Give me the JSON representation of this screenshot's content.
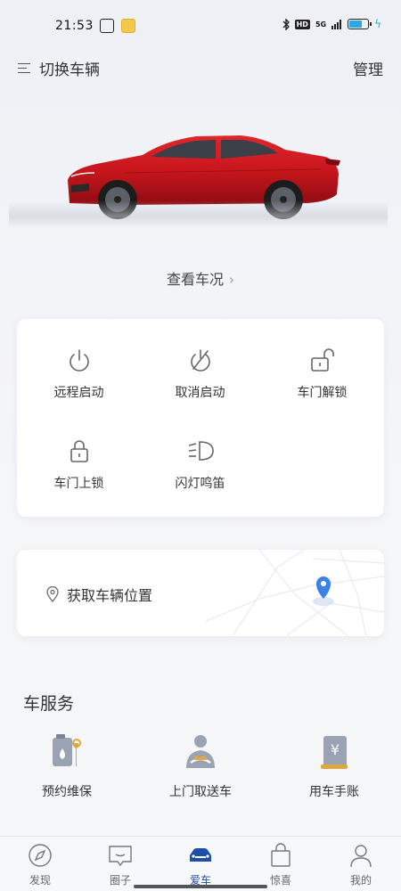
{
  "status_bar": {
    "time": "21:53",
    "network": "5G",
    "hd": "HD",
    "battery_level": 0.75,
    "app_icons": [
      "app-notification-icon",
      "app-yellow-icon"
    ]
  },
  "header": {
    "switch_vehicle": "切换车辆",
    "manage": "管理"
  },
  "car": {
    "color": "#c8161d",
    "view_status_label": "查看车况",
    "chevron": "›"
  },
  "controls": [
    {
      "label": "远程启动",
      "icon": "power-icon"
    },
    {
      "label": "取消启动",
      "icon": "power-off-icon"
    },
    {
      "label": "车门解锁",
      "icon": "unlock-icon"
    },
    {
      "label": "车门上锁",
      "icon": "lock-icon"
    },
    {
      "label": "闪灯鸣笛",
      "icon": "headlight-icon"
    }
  ],
  "location": {
    "label": "获取车辆位置",
    "pin_color": "#3b82e8"
  },
  "services": {
    "title": "车服务",
    "items": [
      {
        "label": "预约维保",
        "icon": "maintenance-icon"
      },
      {
        "label": "上门取送车",
        "icon": "driver-icon"
      },
      {
        "label": "用车手账",
        "icon": "ledger-icon"
      }
    ]
  },
  "tabbar": {
    "items": [
      {
        "label": "发现",
        "icon": "compass-icon",
        "active": false
      },
      {
        "label": "圈子",
        "icon": "chat-icon",
        "active": false
      },
      {
        "label": "爱车",
        "icon": "car-icon",
        "active": true
      },
      {
        "label": "惊喜",
        "icon": "bag-icon",
        "active": false
      },
      {
        "label": "我的",
        "icon": "profile-icon",
        "active": false
      }
    ],
    "active_color": "#1e4ea8"
  }
}
